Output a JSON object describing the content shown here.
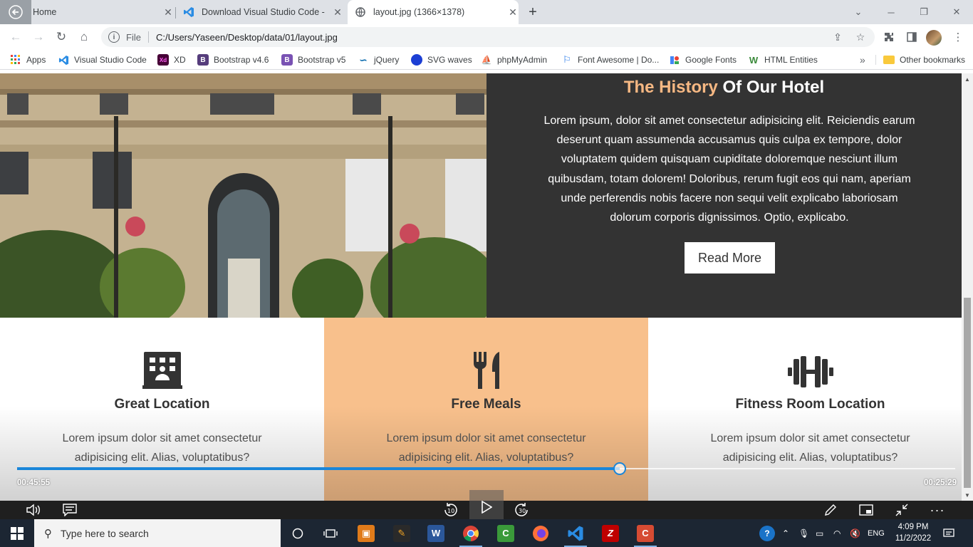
{
  "browser": {
    "tabs": [
      {
        "title": "Home",
        "active": false
      },
      {
        "title": "Download Visual Studio Code - M",
        "active": false
      },
      {
        "title": "layout.jpg (1366×1378)",
        "active": true
      }
    ],
    "address": {
      "scheme": "File",
      "url": "C:/Users/Yaseen/Desktop/data/01/layout.jpg"
    },
    "bookmarks": [
      {
        "label": "Apps",
        "icon": "apps-grid-icon"
      },
      {
        "label": "Visual Studio Code",
        "icon": "vscode-icon"
      },
      {
        "label": "XD",
        "icon": "xd-icon"
      },
      {
        "label": "Bootstrap v4.6",
        "icon": "bootstrap-icon"
      },
      {
        "label": "Bootstrap v5",
        "icon": "bootstrap-icon"
      },
      {
        "label": "jQuery",
        "icon": "jquery-icon"
      },
      {
        "label": "SVG waves",
        "icon": "svg-waves-icon"
      },
      {
        "label": "phpMyAdmin",
        "icon": "phpmyadmin-icon"
      },
      {
        "label": "Font Awesome | Do...",
        "icon": "flag-icon"
      },
      {
        "label": "Google Fonts",
        "icon": "google-fonts-icon"
      },
      {
        "label": "HTML Entities",
        "icon": "w-icon"
      }
    ],
    "other_bookmarks": "Other bookmarks"
  },
  "page": {
    "history": {
      "title_accent": "The History",
      "title_rest": " Of Our Hotel",
      "body": "Lorem ipsum, dolor sit amet consectetur adipisicing elit. Reiciendis earum deserunt quam assumenda accusamus quis culpa ex tempore, dolor voluptatem quidem quisquam cupiditate doloremque nesciunt illum quibusdam, totam dolorem! Doloribus, rerum fugit eos qui nam, aperiam unde perferendis nobis facere non sequi velit explicabo laboriosam dolorum corporis dignissimos. Optio, explicabo.",
      "button": "Read More"
    },
    "features": [
      {
        "title": "Great Location",
        "text": "Lorem ipsum dolor sit amet consectetur adipisicing elit. Alias, voluptatibus?",
        "icon": "building-icon"
      },
      {
        "title": "Free Meals",
        "text": "Lorem ipsum dolor sit amet consectetur adipisicing elit. Alias, voluptatibus?",
        "icon": "utensils-icon"
      },
      {
        "title": "Fitness Room Location",
        "text": "Lorem ipsum dolor sit amet consectetur adipisicing elit. Alias, voluptatibus?",
        "icon": "dumbbell-icon"
      }
    ],
    "colors": {
      "dark": "#333333",
      "accent": "#f6b883",
      "orange_panel": "#f8c08c"
    }
  },
  "player": {
    "elapsed": "00:45:55",
    "remaining": "00:25:29",
    "progress": 0.642,
    "rewind_label": "10",
    "forward_label": "30",
    "accent": "#1a86d9"
  },
  "taskbar": {
    "search_placeholder": "Type here to search",
    "language": "ENG",
    "time": "4:09 PM",
    "date": "11/2/2022"
  }
}
